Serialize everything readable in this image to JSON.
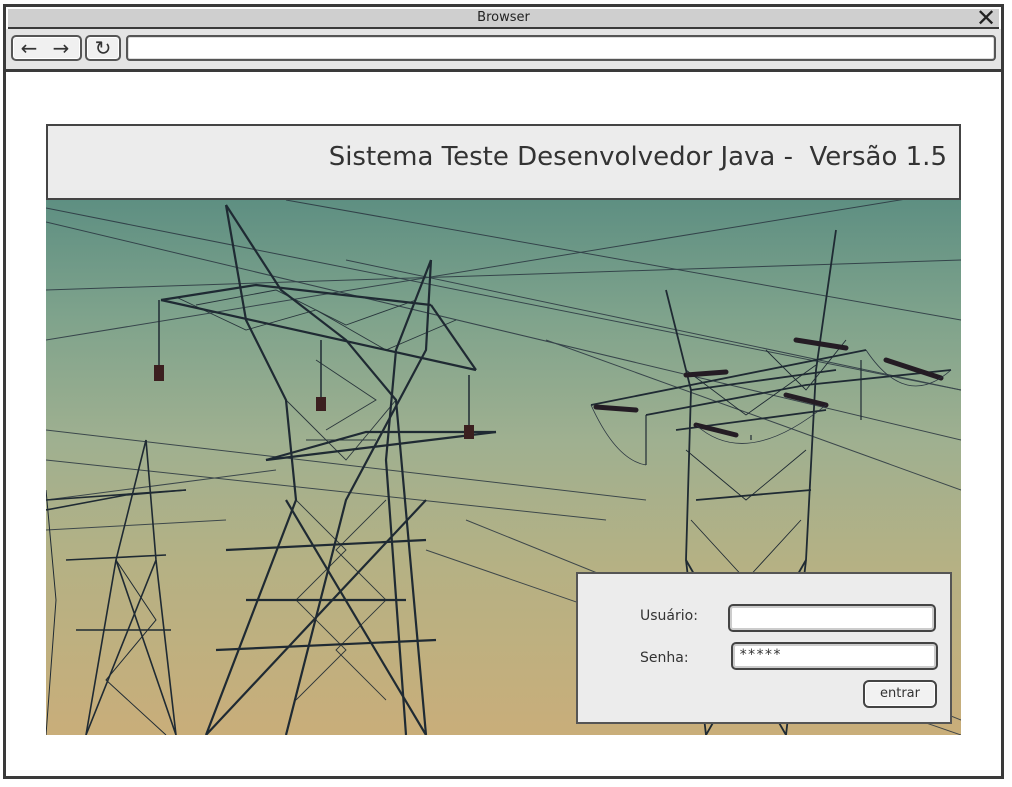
{
  "browser": {
    "title": "Browser",
    "close_icon": "✕",
    "back_icon": "←",
    "forward_icon": "→",
    "reload_icon": "↻",
    "address_value": ""
  },
  "header": {
    "title": "Sistema Teste Desenvolvedor Java -  Versão 1.5"
  },
  "hero_image": {
    "subject": "power-transmission-towers"
  },
  "login": {
    "username_label": "Usuário:",
    "username_value": "",
    "password_label": "Senha:",
    "password_value": "*****",
    "submit_label": "entrar"
  },
  "colors": {
    "sky_top": "#5e8f82",
    "sky_bottom": "#c9ae7a",
    "tower": "#1f2a33",
    "panel_bg": "#ececec"
  }
}
